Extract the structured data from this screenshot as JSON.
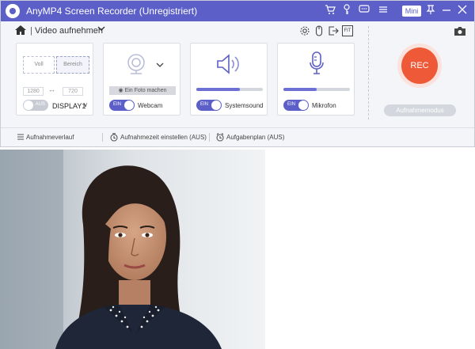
{
  "titlebar": {
    "title": "AnyMP4 Screen Recorder (Unregistriert)",
    "mini_label": "Mini",
    "icons": [
      "cart-icon",
      "key-icon",
      "chat-icon",
      "menu-icon",
      "pin-icon",
      "minimize-icon",
      "close-icon"
    ]
  },
  "toolbar": {
    "separator": "|",
    "mode": "Video aufnehmen",
    "icons": [
      "settings-icon",
      "mouse-icon",
      "export-icon",
      "fit-icon"
    ],
    "fit_label": "FIT"
  },
  "display_card": {
    "full_label": "Voll",
    "area_label": "Bereich",
    "width": "1280",
    "link_symbol": "↔",
    "height": "720",
    "toggle_label": "AUS",
    "display_name": "DISPLAY1",
    "display_chevron": "∨"
  },
  "webcam_card": {
    "photo_button": "Ein Foto machen",
    "toggle_label": "EIN",
    "label": "Webcam"
  },
  "system_sound_card": {
    "toggle_label": "EIN",
    "label": "Systemsound",
    "volume": 0.65
  },
  "mic_card": {
    "toggle_label": "EIN",
    "label": "Mikrofon",
    "volume": 0.5
  },
  "rec": {
    "button_label": "REC",
    "mode_label": "Aufnahmemodus"
  },
  "bottombar": {
    "history": "Aufnahmeverlauf",
    "timer": "Aufnahmezeit einstellen (AUS)",
    "schedule": "Aufgabenplan (AUS)"
  },
  "colors": {
    "accent": "#5b5fc7",
    "rec": "#ee5a38"
  }
}
